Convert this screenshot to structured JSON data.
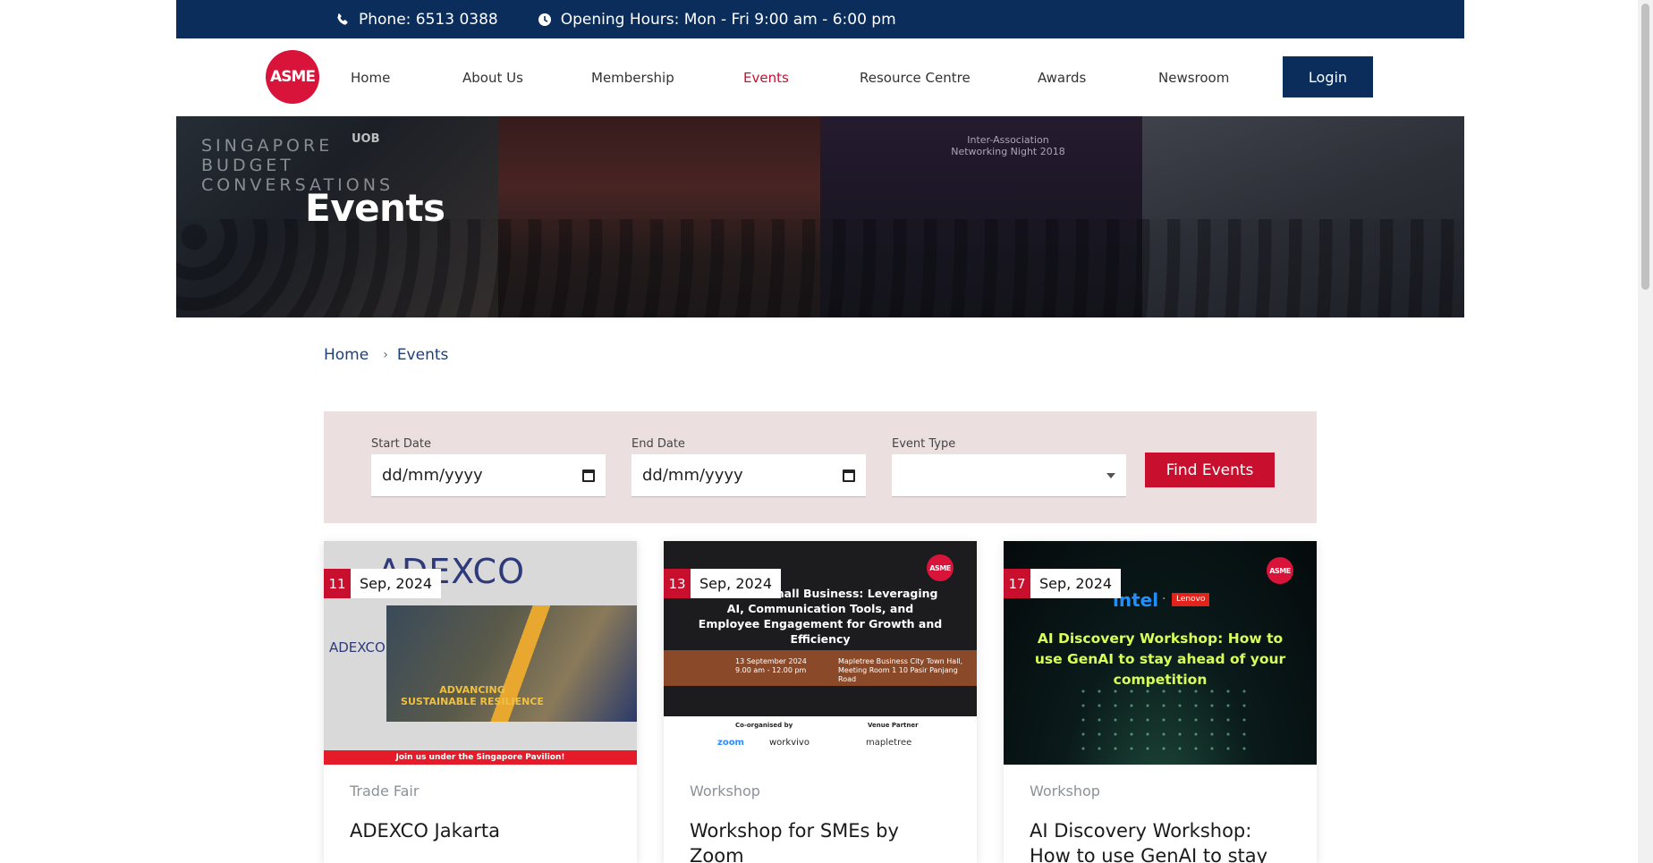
{
  "topbar": {
    "phone": "Phone: 6513 0388",
    "hours": "Opening Hours: Mon - Fri 9:00 am - 6:00 pm"
  },
  "logo": {
    "text": "ASME"
  },
  "nav": {
    "items": [
      {
        "label": "Home"
      },
      {
        "label": "About Us"
      },
      {
        "label": "Membership"
      },
      {
        "label": "Events",
        "active": true
      },
      {
        "label": "Resource Centre"
      },
      {
        "label": "Awards"
      },
      {
        "label": "Newsroom"
      }
    ],
    "login": "Login"
  },
  "hero": {
    "title": "Events",
    "photo_text_1": "SINGAPORE BUDGET CONVERSATIONS",
    "photo_text_2": "UOB",
    "photo_text_3": "Inter-Association Networking Night 2018"
  },
  "breadcrumb": {
    "home": "Home",
    "current": "Events"
  },
  "filter": {
    "start_label": "Start Date",
    "start_value": "dd/mm/yyyy",
    "end_label": "End Date",
    "end_value": "dd/mm/yyyy",
    "type_label": "Event Type",
    "type_value": "",
    "button": "Find Events"
  },
  "events": [
    {
      "day": "11",
      "month": "Sep, 2024",
      "type": "Trade Fair",
      "title": "ADEXCO Jakarta",
      "poster": {
        "brand": "ADEXCO",
        "side": "ADEXCO",
        "tagline": "ADVANCING SUSTAINABLE RESILIENCE",
        "footer": "Join us under the Singapore Pavilion!"
      }
    },
    {
      "day": "13",
      "month": "Sep, 2024",
      "type": "Workshop",
      "title": "Workshop for SMEs by Zoom",
      "poster": {
        "headline": "...er Your Small Business: Leveraging AI, Communication Tools, and Employee Engagement for Growth and Efficiency",
        "date_info": "13 September 2024 9.00 am - 12.00 pm",
        "venue_info": "Mapletree Business City Town Hall, Meeting Room 1 10 Pasir Panjang Road",
        "co_label": "Co-organised by",
        "venue_label": "Venue Partner",
        "sponsor_1": "zoom",
        "sponsor_2": "workvivo",
        "sponsor_3": "mapletree"
      }
    },
    {
      "day": "17",
      "month": "Sep, 2024",
      "type": "Workshop",
      "title": "AI Discovery Workshop: How to use GenAI to stay ahead...",
      "poster": {
        "brand_1": "intel",
        "separator": "·",
        "brand_2": "Lenovo",
        "headline": "AI Discovery Workshop: How to use GenAI to stay ahead of your competition"
      }
    }
  ],
  "colors": {
    "navy": "#0b2d5b",
    "brand_red": "#c8102e",
    "filter_bg": "#ecdfe0"
  }
}
